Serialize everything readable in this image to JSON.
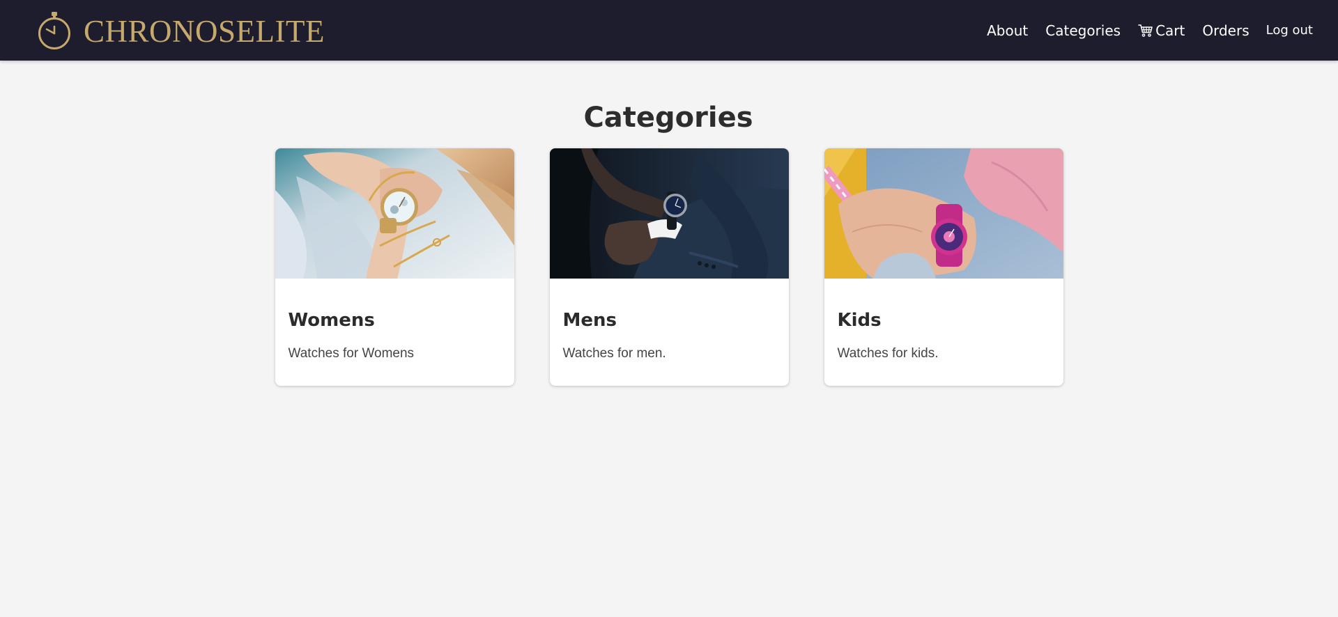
{
  "header": {
    "brand_name": "CHRONOSELITE",
    "brand_icon": "stopwatch-icon",
    "nav": {
      "about": "About",
      "categories": "Categories",
      "cart": "Cart",
      "cart_icon": "cart-icon",
      "orders": "Orders",
      "logout": "Log out"
    }
  },
  "main": {
    "title": "Categories",
    "cards": [
      {
        "title": "Womens",
        "description": "Watches for Womens",
        "image": "womens-watch-photo"
      },
      {
        "title": "Mens",
        "description": "Watches for men.",
        "image": "mens-watch-photo"
      },
      {
        "title": "Kids",
        "description": "Watches for kids.",
        "image": "kids-watch-photo"
      }
    ]
  },
  "colors": {
    "header_bg": "#1e1d2e",
    "brand_gold": "#c6a96c",
    "page_bg": "#f4f4f4",
    "card_bg": "#ffffff",
    "text_dark": "#2b2b2b"
  }
}
